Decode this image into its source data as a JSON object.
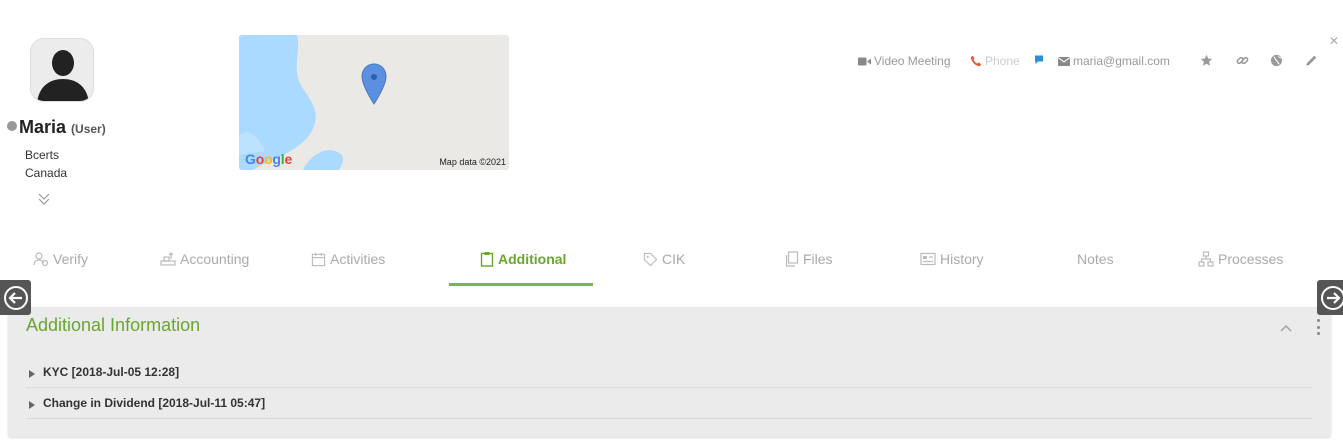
{
  "profile": {
    "name": "Maria",
    "role": "(User)",
    "company": "Bcerts",
    "country": "Canada"
  },
  "map": {
    "logo": "Google",
    "attribution": "Map data ©2021"
  },
  "actions": {
    "video_meeting": "Video Meeting",
    "phone": "Phone",
    "email": "maria@gmail.com"
  },
  "tabs": [
    {
      "label": "Verify",
      "icon": "verify-icon"
    },
    {
      "label": "Accounting",
      "icon": "accounting-icon"
    },
    {
      "label": "Activities",
      "icon": "calendar-icon"
    },
    {
      "label": "Additional",
      "icon": "clipboard-icon"
    },
    {
      "label": "CIK",
      "icon": "tag-icon"
    },
    {
      "label": "Files",
      "icon": "files-icon"
    },
    {
      "label": "History",
      "icon": "history-icon"
    },
    {
      "label": "Notes",
      "icon": ""
    },
    {
      "label": "Processes",
      "icon": "processes-icon"
    }
  ],
  "active_tab": "Additional",
  "panel": {
    "title": "Additional Information",
    "rows": [
      {
        "label": "KYC [2018-Jul-05 12:28]"
      },
      {
        "label": "Change in Dividend [2018-Jul-11 05:47]"
      }
    ]
  },
  "colors": {
    "accent_green": "#6aa62e",
    "phone_red": "#e05a3a",
    "chat_blue": "#2a8fd6",
    "pin_blue": "#5b8fe0"
  }
}
